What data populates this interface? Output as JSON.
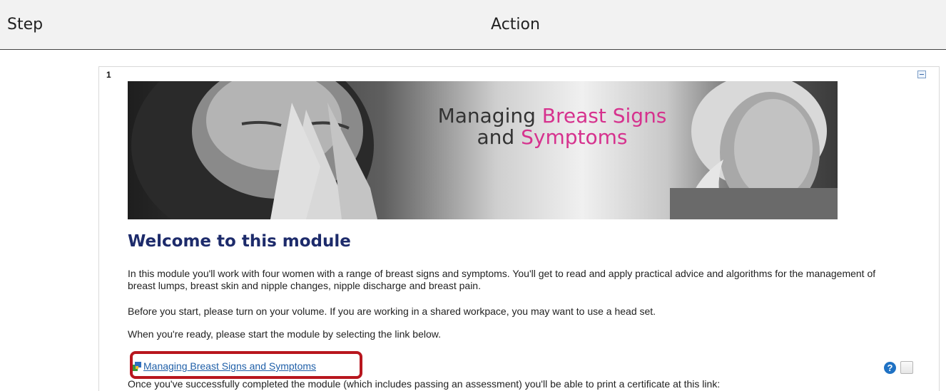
{
  "header": {
    "step_label": "Step",
    "action_label": "Action"
  },
  "section": {
    "number": "1"
  },
  "banner": {
    "title_part1": "Managing ",
    "title_part2": "Breast Signs",
    "title_part3": "and ",
    "title_part4": "Symptoms"
  },
  "content": {
    "heading": "Welcome to this module",
    "paragraph1": "In this module you'll work with four women with a range of breast signs and symptoms. You'll get to read and apply practical advice and algorithms for the management of breast lumps, breast skin and nipple changes, nipple discharge and breast pain.",
    "paragraph2": "Before you start, please turn on your volume. If you are working in a shared workpace, you may want to use a head set.",
    "paragraph3": "When you're ready, please start the module by selecting the link below.",
    "link_text": "Managing Breast Signs and Symptoms",
    "paragraph4": "Once you've successfully completed the module (which includes passing an assessment) you'll be able to print a certificate at this link:"
  },
  "icons": {
    "help": "?",
    "collapse": "collapse-icon",
    "resource": "resource-icon",
    "completion": "checkbox"
  },
  "colors": {
    "heading": "#1d2b6b",
    "link": "#1f5fa8",
    "highlight": "#b8161e",
    "banner_accent": "#d6328e"
  }
}
